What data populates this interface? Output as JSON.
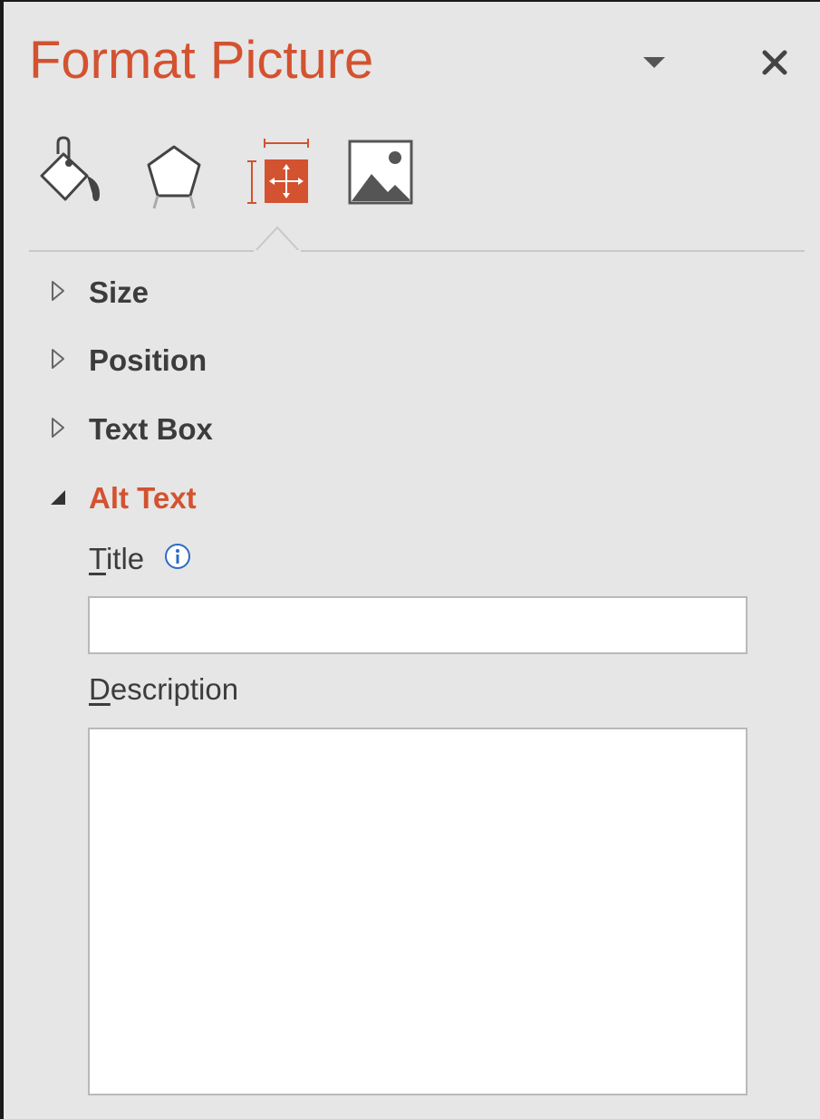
{
  "pane": {
    "title": "Format Picture",
    "accent_color": "#d35230",
    "icons": {
      "dropdown": "chevron-down-icon",
      "close": "close-icon"
    }
  },
  "tabs": [
    {
      "name": "Fill & Line",
      "icon": "paint-bucket-icon",
      "selected": false
    },
    {
      "name": "Effects",
      "icon": "pentagon-icon",
      "selected": false
    },
    {
      "name": "Size & Properties",
      "icon": "size-properties-icon",
      "selected": true
    },
    {
      "name": "Picture",
      "icon": "picture-icon",
      "selected": false
    }
  ],
  "sections": [
    {
      "label": "Size",
      "expanded": false
    },
    {
      "label": "Position",
      "expanded": false
    },
    {
      "label": "Text Box",
      "expanded": false
    },
    {
      "label": "Alt Text",
      "expanded": true
    }
  ],
  "alt_text": {
    "title_label_mnemonic": "T",
    "title_label_rest": "itle",
    "title_value": "",
    "description_label_mnemonic": "D",
    "description_label_rest": "escription",
    "description_value": ""
  }
}
